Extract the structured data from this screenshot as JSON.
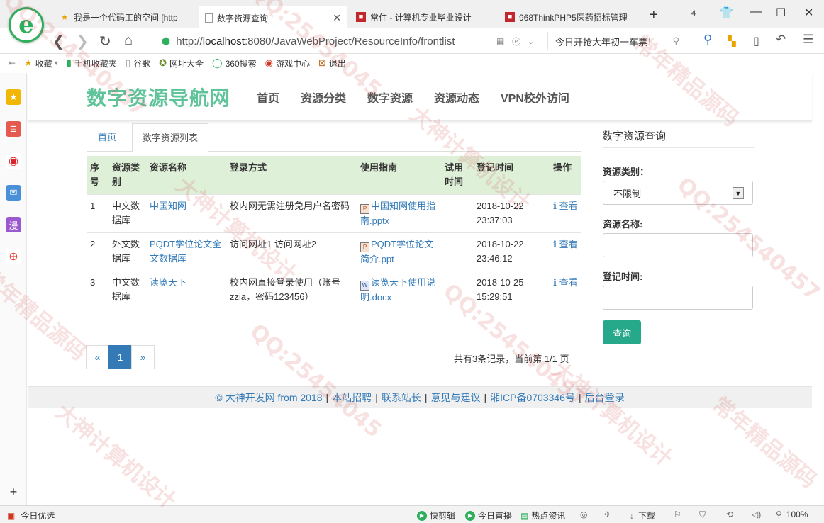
{
  "browser": {
    "tabs": [
      {
        "title": "我是一个代码工的空间 [http",
        "icon": "star-icon"
      },
      {
        "title": "数字资源查询",
        "icon": "page-icon",
        "active": true
      },
      {
        "title": "常住 - 计算机专业毕业设计",
        "icon": "site-icon"
      },
      {
        "title": "968ThinkPHP5医药招标管理",
        "icon": "site-icon"
      }
    ],
    "new_tab": "+",
    "tab_count": "4",
    "url_prefix": "http://",
    "url_host": "localhost",
    "url_rest": ":8080/JavaWebProject/ResourceInfo/frontlist",
    "search_text": "今日开抢大年初一车票！"
  },
  "bookmarks": [
    {
      "label": "收藏",
      "icon": "star-icon"
    },
    {
      "label": "手机收藏夹",
      "icon": "phone-icon"
    },
    {
      "label": "谷歌",
      "icon": "page-icon"
    },
    {
      "label": "网址大全",
      "icon": "compass-icon"
    },
    {
      "label": "360搜索",
      "icon": "search-icon"
    },
    {
      "label": "游戏中心",
      "icon": "game-icon"
    },
    {
      "label": "退出",
      "icon": "exit-icon"
    }
  ],
  "site": {
    "brand": "数字资源导航网",
    "nav": [
      "首页",
      "资源分类",
      "数字资源",
      "资源动态",
      "VPN校外访问"
    ]
  },
  "breadcrumb": {
    "home": "首页",
    "current": "数字资源列表"
  },
  "table": {
    "headers": [
      "序号",
      "资源类别",
      "资源名称",
      "登录方式",
      "使用指南",
      "试用时间",
      "登记时间",
      "操作"
    ],
    "rows": [
      {
        "no": "1",
        "category": "中文数据库",
        "name": "中国知网",
        "login": "校内网无需注册免用户名密码",
        "guide": "中国知网使用指南.pptx",
        "trial": "",
        "time": "2018-10-22 23:37:03",
        "action": "查看"
      },
      {
        "no": "2",
        "category": "外文数据库",
        "name": "PQDT学位论文全文数据库",
        "login": "访问网址1 访问网址2",
        "guide": "PQDT学位论文简介.ppt",
        "trial": "",
        "time": "2018-10-22 23:46:12",
        "action": "查看"
      },
      {
        "no": "3",
        "category": "中文数据库",
        "name": "读览天下",
        "login": "校内网直接登录使用（账号zzia，密码123456）",
        "guide": "读览天下使用说明.docx",
        "trial": "",
        "time": "2018-10-25 15:29:51",
        "action": "查看"
      }
    ]
  },
  "pagination": {
    "prev": "«",
    "current": "1",
    "next": "»",
    "summary": "共有3条记录，当前第 1/1 页"
  },
  "search_panel": {
    "title": "数字资源查询",
    "type_label": "资源类别：",
    "type_value": "不限制",
    "name_label": "资源名称:",
    "name_value": "",
    "date_label": "登记时间:",
    "date_value": "",
    "button": "查询"
  },
  "footer": [
    "© 大神开发网 from 2018",
    "本站招聘",
    "联系站长",
    "意见与建议",
    "湘ICP备0703346号",
    "后台登录"
  ],
  "statusbar": {
    "left": "今日优选",
    "items": [
      "快剪辑",
      "今日直播",
      "热点资讯",
      "下载"
    ],
    "zoom": "100%"
  },
  "watermark": [
    "QQ:25454045",
    "大神计算机设计",
    "常年精品源码",
    "QQ:254540457"
  ],
  "colors": {
    "brand": "#5fc49a",
    "link": "#337ab7",
    "table_header": "#dff0d8",
    "button": "#26a88a"
  }
}
